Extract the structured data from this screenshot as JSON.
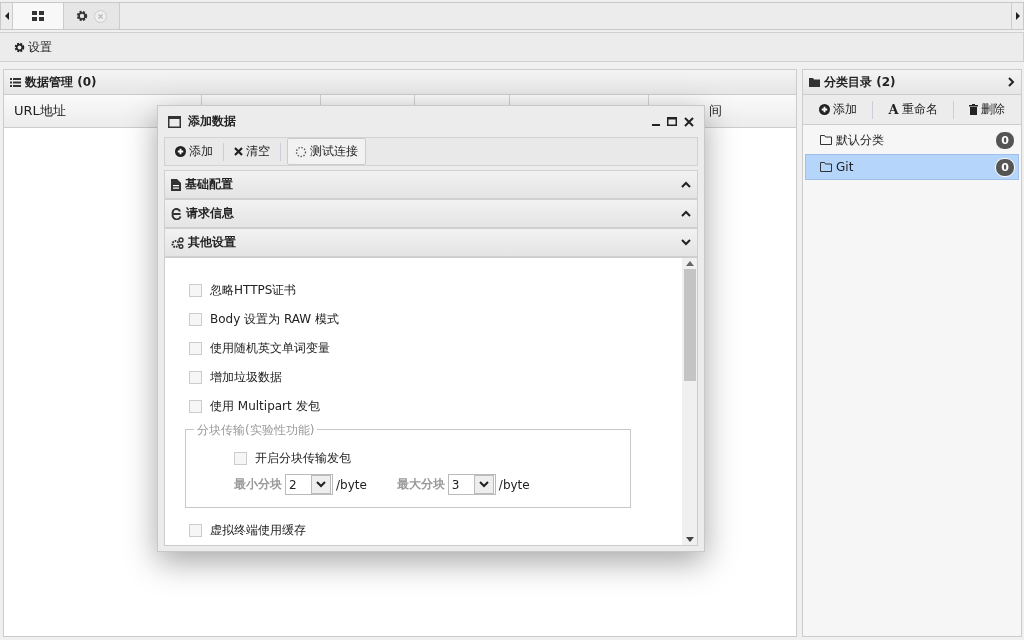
{
  "tabs": [
    {
      "kind": "grid",
      "selected": true,
      "closable": false
    },
    {
      "kind": "gear",
      "selected": false,
      "closable": true
    }
  ],
  "toolbar": {
    "settings_button": "设置"
  },
  "data_panel": {
    "title": "数据管理 (0)",
    "column_first": "URL地址",
    "column_last": "间"
  },
  "category_panel": {
    "title": "分类目录 (2)",
    "buttons": [
      {
        "kind": "add",
        "label": "添加"
      },
      {
        "kind": "rename",
        "icon_text": "A",
        "label": "重命名"
      },
      {
        "kind": "delete",
        "label": "删除"
      }
    ],
    "items": [
      {
        "label": "默认分类",
        "count": "0",
        "selected": false
      },
      {
        "label": "Git",
        "count": "0",
        "selected": true
      }
    ]
  },
  "dialog": {
    "title": "添加数据",
    "toolbar": [
      {
        "kind": "add",
        "label": "添加"
      },
      {
        "kind": "clear",
        "label": "清空"
      },
      {
        "kind": "test",
        "label": "测试连接"
      }
    ],
    "sections": [
      {
        "kind": "doc",
        "title": "基础配置",
        "expanded": false
      },
      {
        "kind": "ie",
        "title": "请求信息",
        "expanded": false
      },
      {
        "kind": "gears",
        "title": "其他设置",
        "expanded": true
      }
    ],
    "options_before": [
      {
        "label": "忽略HTTPS证书",
        "checked": false
      },
      {
        "label": "Body 设置为 RAW 模式",
        "checked": false
      },
      {
        "label": "使用随机英文单词变量",
        "checked": false
      },
      {
        "label": "增加垃圾数据",
        "checked": false
      },
      {
        "label": "使用 Multipart 发包",
        "checked": false
      }
    ],
    "chunked": {
      "legend": "分块传输(实验性功能)",
      "option": {
        "label": "开启分块传输发包",
        "checked": false
      },
      "selects": [
        {
          "label": "最小分块",
          "value": "2",
          "unit": "/byte"
        },
        {
          "label": "最大分块",
          "value": "3",
          "unit": "/byte"
        }
      ]
    },
    "options_after": [
      {
        "label": "虚拟终端使用缓存",
        "checked": false
      }
    ]
  }
}
